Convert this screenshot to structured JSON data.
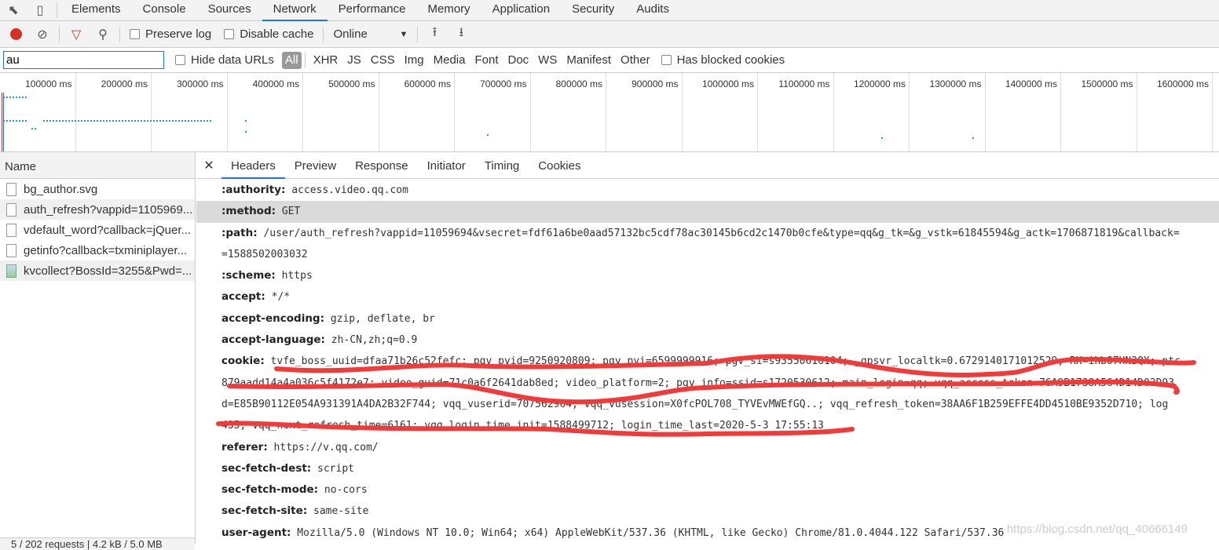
{
  "tabs": [
    "Elements",
    "Console",
    "Sources",
    "Network",
    "Performance",
    "Memory",
    "Application",
    "Security",
    "Audits"
  ],
  "toolbar": {
    "preserve_log": "Preserve log",
    "disable_cache": "Disable cache",
    "throttle": "Online"
  },
  "filter": {
    "value": "au",
    "hide_data_urls": "Hide data URLs",
    "types": [
      "All",
      "XHR",
      "JS",
      "CSS",
      "Img",
      "Media",
      "Font",
      "Doc",
      "WS",
      "Manifest",
      "Other"
    ],
    "blocked": "Has blocked cookies"
  },
  "overview": {
    "ticks": [
      "100000 ms",
      "200000 ms",
      "300000 ms",
      "400000 ms",
      "500000 ms",
      "600000 ms",
      "700000 ms",
      "800000 ms",
      "900000 ms",
      "1000000 ms",
      "1100000 ms",
      "1200000 ms",
      "1300000 ms",
      "1400000 ms",
      "1500000 ms",
      "1600000 ms"
    ],
    "bar_color": "#1a9fd0"
  },
  "requests": {
    "header": "Name",
    "items": [
      "bg_author.svg",
      "auth_refresh?vappid=1105969...",
      "vdefault_word?callback=jQuer...",
      "getinfo?callback=txminiplayer...",
      "kvcollect?BossId=3255&Pwd=..."
    ],
    "status": "5 / 202 requests  |  4.2 kB / 5.0 MB"
  },
  "detail": {
    "tabs": [
      "Headers",
      "Preview",
      "Response",
      "Initiator",
      "Timing",
      "Cookies"
    ],
    "headers": [
      {
        "k": ":authority:",
        "v": "access.video.qq.com"
      },
      {
        "k": ":method:",
        "v": "GET"
      },
      {
        "k": ":path:",
        "v": "/user/auth_refresh?vappid=11059694&vsecret=fdf61a6be0aad57132bc5cdf78ac30145b6cd2c1470b0cfe&type=qq&g_tk=&g_vstk=61845594&g_actk=1706871819&callback=",
        "cont": "=1588502003032"
      },
      {
        "k": ":scheme:",
        "v": "https"
      },
      {
        "k": "accept:",
        "v": "*/*"
      },
      {
        "k": "accept-encoding:",
        "v": "gzip, deflate, br"
      },
      {
        "k": "accept-language:",
        "v": "zh-CN,zh;q=0.9"
      },
      {
        "k": "cookie:",
        "v": "tvfe_boss_uuid=dfaa71b26c52fefc; pgv_pvid=9250920809; pgv_pvi=6599999916; pgv_si=s93550616104; _qpsvr_localtk=0.6729140171012529; RK=ihbO7HN3QX; ptc",
        "cont": "879aadd14a4a036c5f4172e7; video_guid=71c0a6f2641dab8ed; video_platform=2; pgv_info=ssid=s1720530612; main_login=qq; vqq_access_token=76A9B1738A564D14D03D93",
        "cont2": "d=E85B90112E054A931391A4DA2B32F744; vqq_vuserid=707562964; vqq_vusession=X0fcPOL708_TYVEvMWEfGQ..; vqq_refresh_token=38AA6F1B259EFFE4DD4510BE9352D710; log",
        "cont3": "435; vqq_next_refresh_time=6161; vqq_login_time_init=1588499712; login_time_last=2020-5-3 17:55:13"
      },
      {
        "k": "referer:",
        "v": "https://v.qq.com/"
      },
      {
        "k": "sec-fetch-dest:",
        "v": "script"
      },
      {
        "k": "sec-fetch-mode:",
        "v": "no-cors"
      },
      {
        "k": "sec-fetch-site:",
        "v": "same-site"
      },
      {
        "k": "user-agent:",
        "v": "Mozilla/5.0 (Windows NT 10.0; Win64; x64) AppleWebKit/537.36 (KHTML, like Gecko) Chrome/81.0.4044.122 Safari/537.36"
      }
    ]
  },
  "watermark": "https://blog.csdn.net/qq_40666149",
  "colors": {
    "accent": "#1a73e8",
    "record": "#d93025",
    "scribble": "#f23a3a"
  }
}
